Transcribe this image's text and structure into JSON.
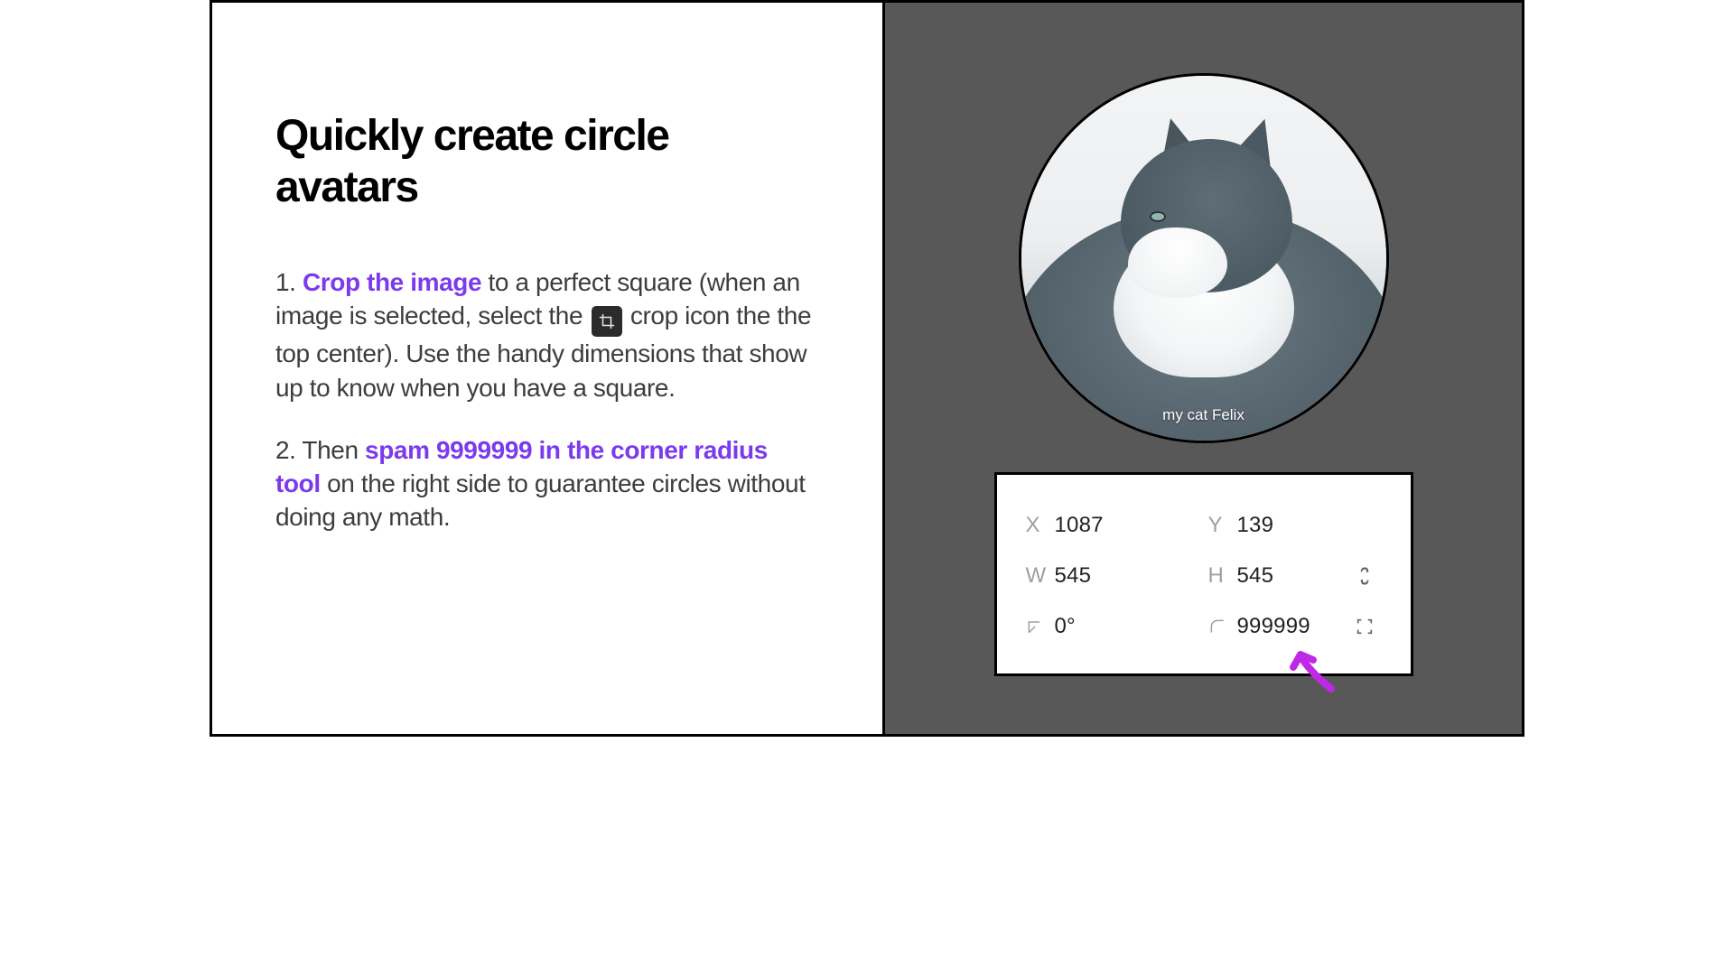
{
  "left": {
    "title": "Quickly create circle avatars",
    "step1": {
      "num": "1. ",
      "hl": "Crop the image",
      "rest_a": " to a perfect square (when an image is selected, select the ",
      "rest_b": " crop icon the the top center). Use the handy dimensions that show up to know when you have a square."
    },
    "step2": {
      "num": "2. Then ",
      "hl": "spam 9999999 in the corner radius tool",
      "rest": " on the right side to guarantee circles without doing any math."
    }
  },
  "right": {
    "caption": "my cat Felix",
    "panel": {
      "x_label": "X",
      "x_value": "1087",
      "y_label": "Y",
      "y_value": "139",
      "w_label": "W",
      "w_value": "545",
      "h_label": "H",
      "h_value": "545",
      "rot_value": "0°",
      "radius_value": "999999"
    }
  }
}
